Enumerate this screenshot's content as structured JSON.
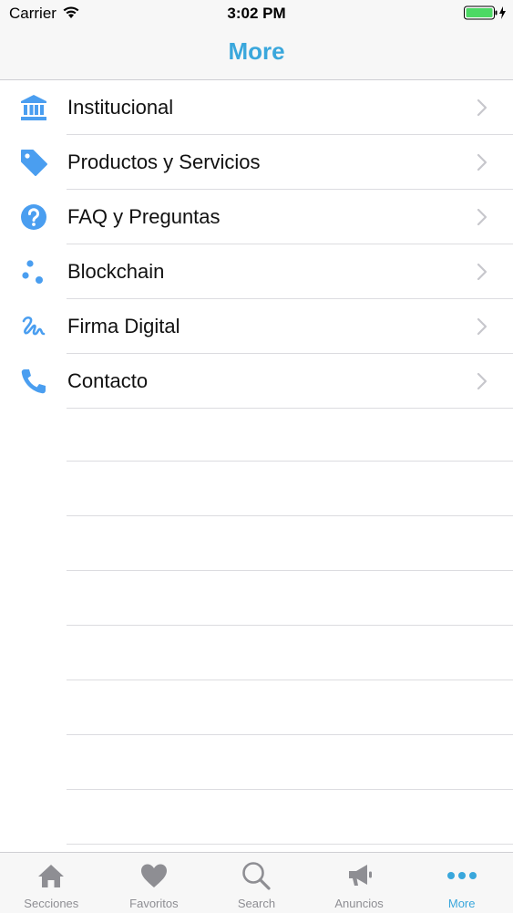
{
  "status_bar": {
    "carrier": "Carrier",
    "time": "3:02 PM"
  },
  "nav": {
    "title": "More"
  },
  "colors": {
    "accent": "#3aa7dc",
    "icon_blue": "#4a9ef0",
    "inactive": "#8e8e93",
    "battery": "#4cd964"
  },
  "menu": {
    "items": [
      {
        "label": "Institucional",
        "icon": "bank-icon"
      },
      {
        "label": "Productos y Servicios",
        "icon": "tag-icon"
      },
      {
        "label": "FAQ y Preguntas",
        "icon": "question-circle-icon"
      },
      {
        "label": "Blockchain",
        "icon": "dots-cluster-icon"
      },
      {
        "label": "Firma Digital",
        "icon": "signature-icon"
      },
      {
        "label": "Contacto",
        "icon": "phone-icon"
      }
    ]
  },
  "tab_bar": {
    "tabs": [
      {
        "label": "Secciones",
        "icon": "home-icon"
      },
      {
        "label": "Favoritos",
        "icon": "heart-icon"
      },
      {
        "label": "Search",
        "icon": "search-icon"
      },
      {
        "label": "Anuncios",
        "icon": "megaphone-icon"
      },
      {
        "label": "More",
        "icon": "more-dots-icon",
        "active": true
      }
    ]
  }
}
